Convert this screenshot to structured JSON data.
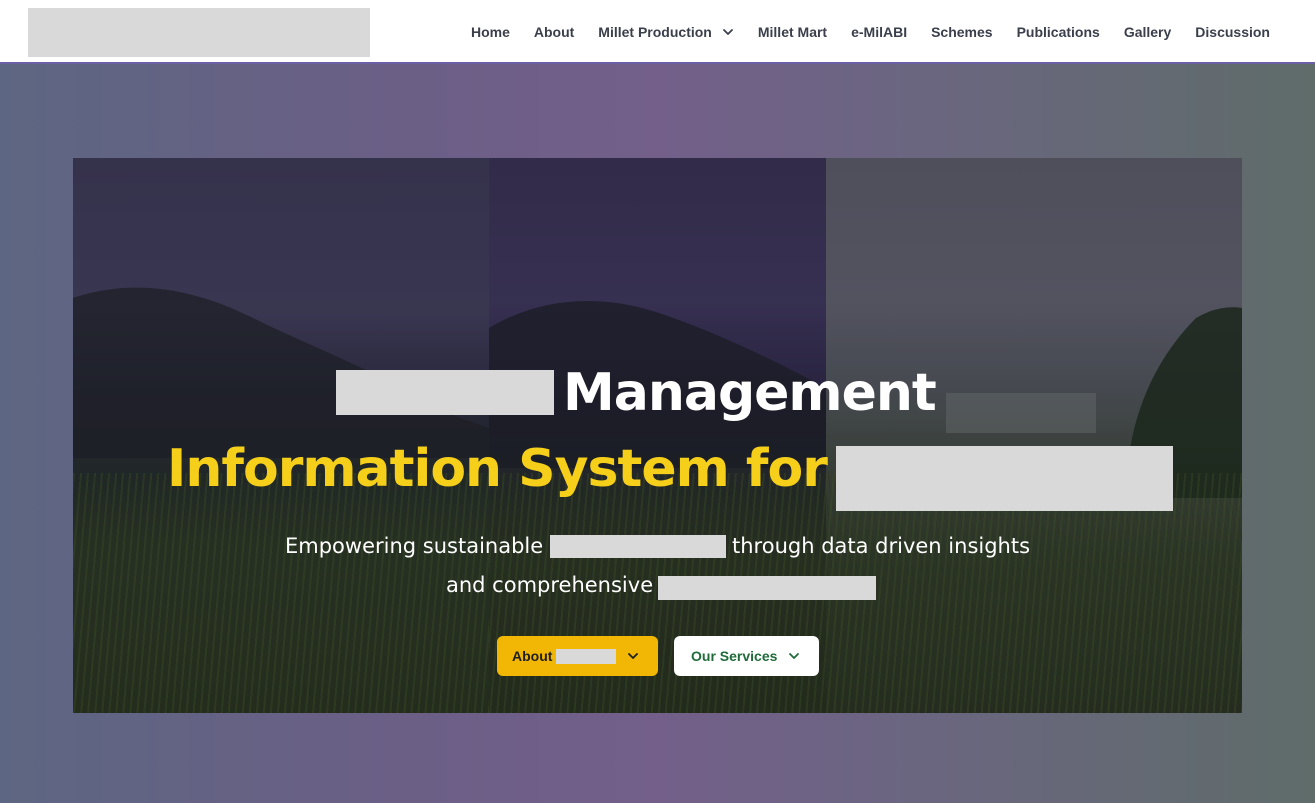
{
  "nav": {
    "items": [
      {
        "label": "Home",
        "dropdown": false
      },
      {
        "label": "About",
        "dropdown": false
      },
      {
        "label": "Millet Production",
        "dropdown": true
      },
      {
        "label": "Millet Mart",
        "dropdown": false
      },
      {
        "label": "e-MilABI",
        "dropdown": false
      },
      {
        "label": "Schemes",
        "dropdown": false
      },
      {
        "label": "Publications",
        "dropdown": false
      },
      {
        "label": "Gallery",
        "dropdown": false
      },
      {
        "label": "Discussion",
        "dropdown": false
      }
    ]
  },
  "hero": {
    "title_line1_visible": "Management",
    "title_line2_visible": "Information System for",
    "subtitle_line1_part1": "Empowering sustainable",
    "subtitle_line1_part2": "through data driven insights",
    "subtitle_line2_part1": "and comprehensive",
    "buttons": {
      "about_label": "About",
      "services_label": "Our Services"
    }
  },
  "colors": {
    "accent_yellow": "#f5cf19",
    "button_yellow": "#f2b705",
    "services_text_green": "#1f6b3a",
    "nav_text": "#3a3f4b",
    "redaction_gray": "#d9d9d9"
  },
  "icons": {
    "dropdown": "chevron-down-icon"
  }
}
